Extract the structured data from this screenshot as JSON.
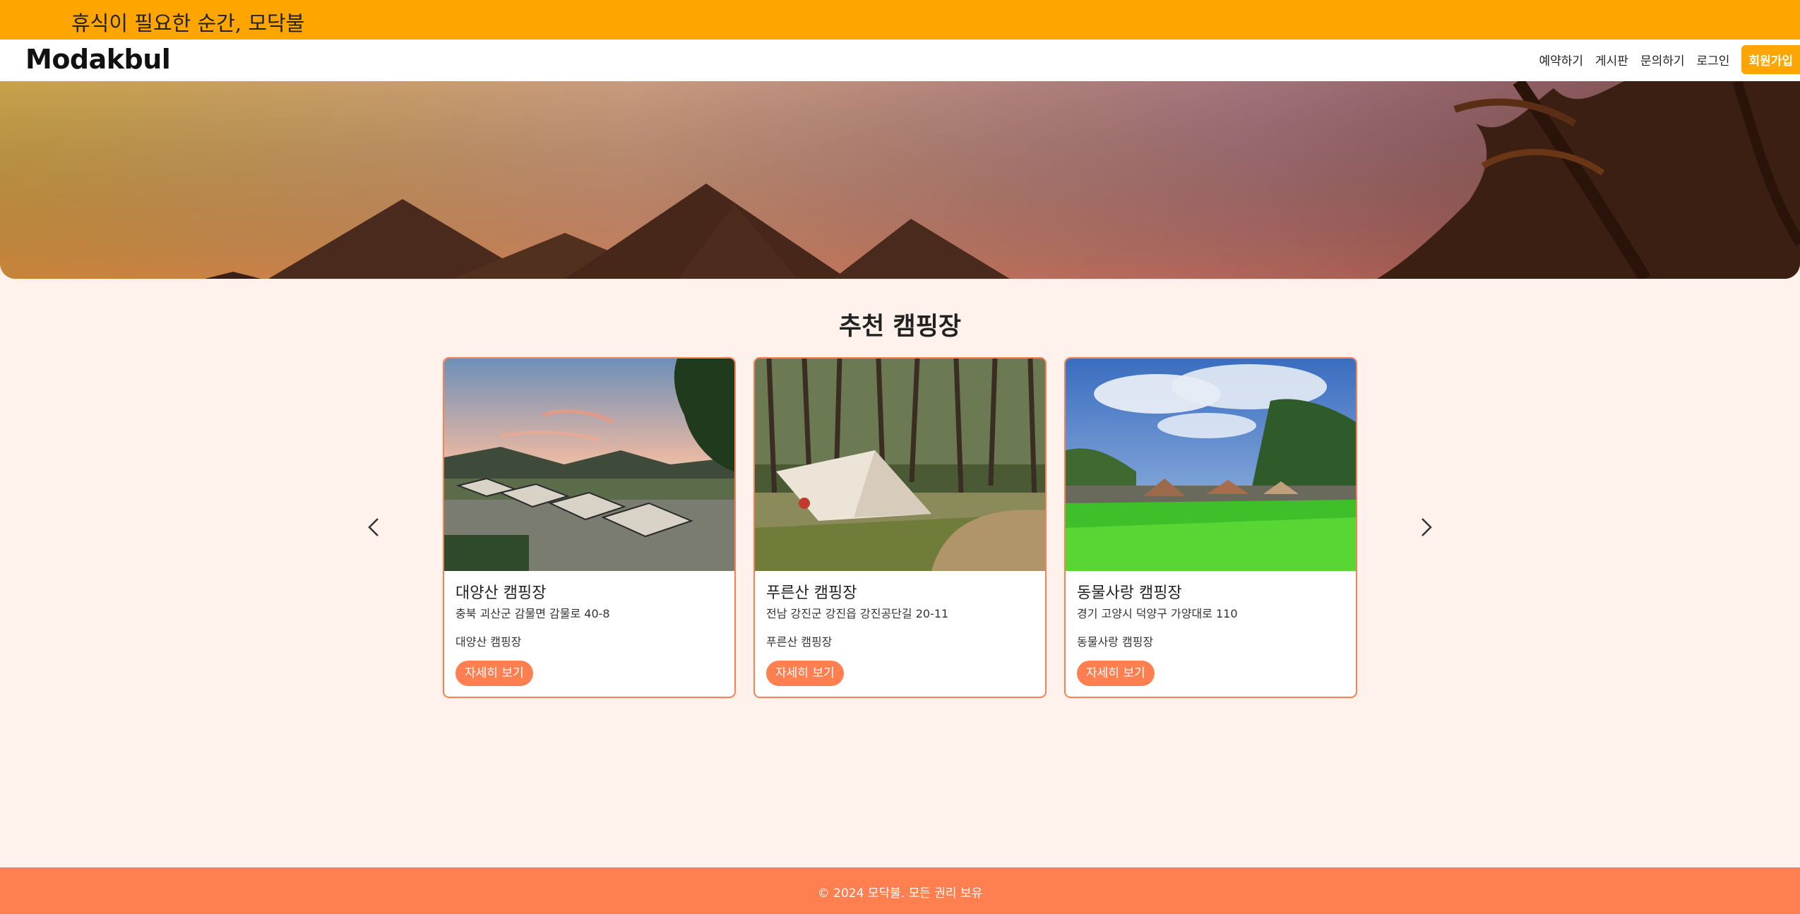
{
  "banner": {
    "slogan": "휴식이 필요한 순간, 모닥불"
  },
  "nav": {
    "logo": "Modakbul",
    "links": [
      {
        "label": "예약하기"
      },
      {
        "label": "게시판"
      },
      {
        "label": "문의하기"
      },
      {
        "label": "로그인"
      }
    ],
    "signup_label": "회원가입"
  },
  "section": {
    "title": "추천 캠핑장"
  },
  "campsites": [
    {
      "name": "대양산 캠핑장",
      "address": "충북 괴산군 감물면 감물로 40-8",
      "description": "대양산 캠핑장",
      "button_label": "자세히 보기"
    },
    {
      "name": "푸른산 캠핑장",
      "address": "전남 강진군 강진읍 강진공단길 20-11",
      "description": "푸른산 캠핑장",
      "button_label": "자세히 보기"
    },
    {
      "name": "동물사랑 캠핑장",
      "address": "경기 고양시 덕양구 가양대로 110",
      "description": "동물사랑 캠핑장",
      "button_label": "자세히 보기"
    }
  ],
  "footer": {
    "copyright": "© 2024 모닥불. 모든 권리 보유"
  },
  "colors": {
    "banner": "#ffa500",
    "accent": "#ff7f50",
    "background": "#fff1ec"
  }
}
